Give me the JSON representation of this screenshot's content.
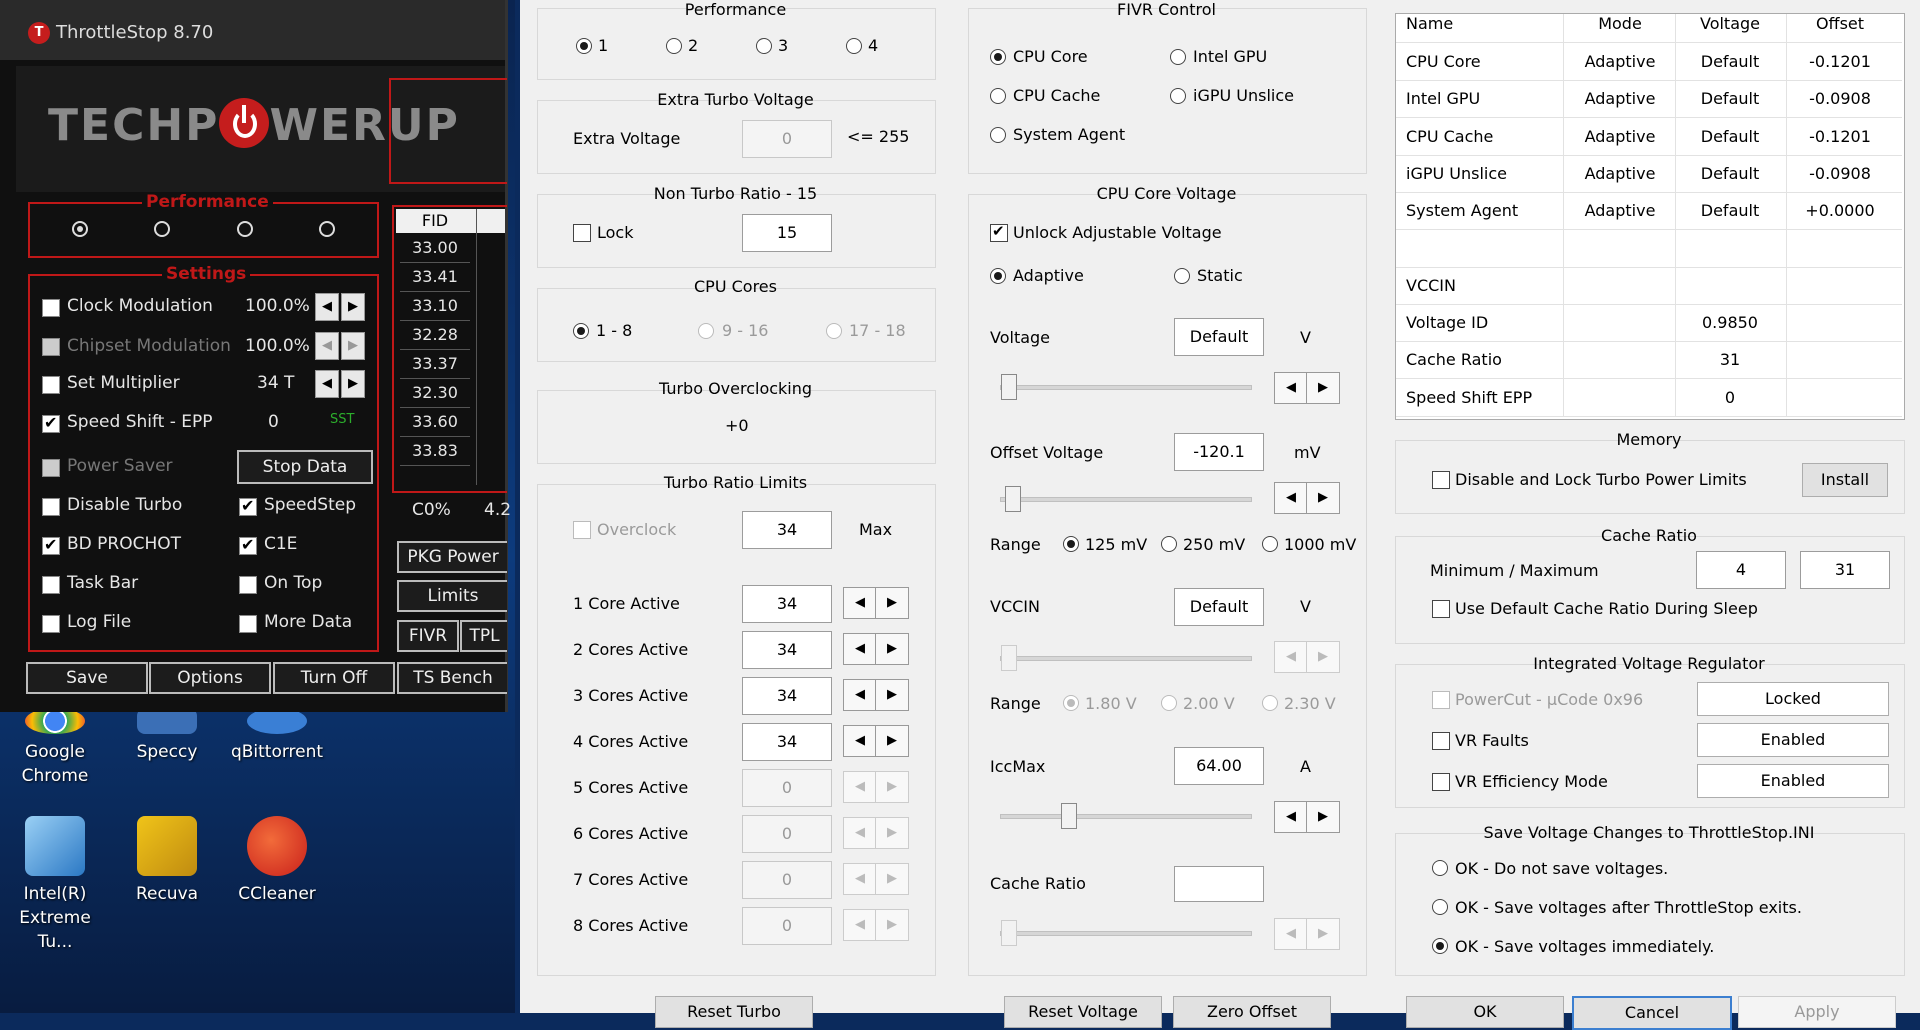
{
  "desktop": {
    "icons": [
      {
        "label1": "Google",
        "label2": "Chrome"
      },
      {
        "label1": "Speccy",
        "label2": ""
      },
      {
        "label1": "qBittorrent",
        "label2": ""
      },
      {
        "label1": "Intel(R)",
        "label2": "Extreme Tu..."
      },
      {
        "label1": "Recuva",
        "label2": ""
      },
      {
        "label1": "CCleaner",
        "label2": ""
      }
    ]
  },
  "ts": {
    "title": "ThrottleStop 8.70",
    "logo_icon": "T",
    "logo_pre": "TECHP",
    "logo_post": "WERUP",
    "performance_label": "Performance",
    "settings_label": "Settings",
    "rows": [
      {
        "label": "Clock Modulation",
        "value": "100.0%",
        "checked": false,
        "dim": false
      },
      {
        "label": "Chipset Modulation",
        "value": "100.0%",
        "checked": false,
        "dim": true
      },
      {
        "label": "Set Multiplier",
        "value": "34 T",
        "checked": false,
        "dim": false
      },
      {
        "label": "Speed Shift - EPP",
        "value": "0",
        "checked": true,
        "dim": false,
        "tag": "SST"
      }
    ],
    "checks": [
      {
        "label": "Power Saver",
        "checked": false,
        "dim": true
      },
      {
        "label": "Disable Turbo",
        "checked": false,
        "dim": false
      },
      {
        "label": "SpeedStep",
        "checked": true,
        "dim": false
      },
      {
        "label": "BD PROCHOT",
        "checked": true,
        "dim": false
      },
      {
        "label": "C1E",
        "checked": true,
        "dim": false
      },
      {
        "label": "Task Bar",
        "checked": false,
        "dim": false
      },
      {
        "label": "On Top",
        "checked": false,
        "dim": false
      },
      {
        "label": "Log File",
        "checked": false,
        "dim": false
      },
      {
        "label": "More Data",
        "checked": false,
        "dim": false
      }
    ],
    "stop_data": "Stop Data",
    "fid_header": "FID",
    "fid_values": [
      "33.00",
      "33.41",
      "33.10",
      "32.28",
      "33.37",
      "32.30",
      "33.60",
      "33.83"
    ],
    "c0_label": "C0%",
    "c0_value": "4.2",
    "side_buttons": [
      "PKG Power",
      "Limits",
      "FIVR",
      "TPL"
    ],
    "bottom_buttons": [
      "Save",
      "Options",
      "Turn Off",
      "TS Bench"
    ]
  },
  "dlg": {
    "performance": {
      "title": "Performance",
      "options": [
        "1",
        "2",
        "3",
        "4"
      ],
      "selected": 0
    },
    "extra_turbo": {
      "title": "Extra Turbo Voltage",
      "label": "Extra Voltage",
      "value": "0",
      "limit": "<= 255"
    },
    "non_turbo": {
      "title": "Non Turbo Ratio - 15",
      "lock": "Lock",
      "value": "15"
    },
    "cpu_cores": {
      "title": "CPU Cores",
      "options": [
        "1 - 8",
        "9 - 16",
        "17 - 18"
      ]
    },
    "turbo_oc": {
      "title": "Turbo Overclocking",
      "value": "+0"
    },
    "turbo_limits": {
      "title": "Turbo Ratio Limits",
      "overclock": "Overclock",
      "oc_value": "34",
      "max": "Max",
      "rows": [
        {
          "label": "1 Core Active",
          "value": "34"
        },
        {
          "label": "2 Cores Active",
          "value": "34"
        },
        {
          "label": "3 Cores Active",
          "value": "34"
        },
        {
          "label": "4 Cores Active",
          "value": "34"
        },
        {
          "label": "5 Cores Active",
          "value": "0"
        },
        {
          "label": "6 Cores Active",
          "value": "0"
        },
        {
          "label": "7 Cores Active",
          "value": "0"
        },
        {
          "label": "8 Cores Active",
          "value": "0"
        }
      ]
    },
    "reset_turbo": "Reset Turbo",
    "fivr_control": {
      "title": "FIVR Control",
      "options": [
        "CPU Core",
        "Intel GPU",
        "CPU Cache",
        "iGPU Unslice",
        "System Agent"
      ]
    },
    "core_voltage": {
      "title": "CPU Core Voltage",
      "unlock": "Unlock Adjustable Voltage",
      "adaptive": "Adaptive",
      "static": "Static",
      "voltage_label": "Voltage",
      "voltage_value": "Default",
      "voltage_unit": "V",
      "offset_label": "Offset Voltage",
      "offset_value": "-120.1",
      "offset_unit": "mV",
      "range_label": "Range",
      "range_options": [
        "125 mV",
        "250 mV",
        "1000 mV"
      ],
      "vccin_label": "VCCIN",
      "vccin_value": "Default",
      "vccin_unit": "V",
      "range2_label": "Range",
      "range2_options": [
        "1.80 V",
        "2.00 V",
        "2.30 V"
      ],
      "iccmax_label": "IccMax",
      "iccmax_value": "64.00",
      "iccmax_unit": "A",
      "cache_label": "Cache Ratio",
      "cache_value": ""
    },
    "reset_voltage": "Reset Voltage",
    "zero_offset": "Zero Offset",
    "table": {
      "headers": [
        "Name",
        "Mode",
        "Voltage",
        "Offset"
      ],
      "rows": [
        [
          "CPU Core",
          "Adaptive",
          "Default",
          "-0.1201"
        ],
        [
          "Intel GPU",
          "Adaptive",
          "Default",
          "-0.0908"
        ],
        [
          "CPU Cache",
          "Adaptive",
          "Default",
          "-0.1201"
        ],
        [
          "iGPU Unslice",
          "Adaptive",
          "Default",
          "-0.0908"
        ],
        [
          "System Agent",
          "Adaptive",
          "Default",
          "+0.0000"
        ],
        [
          "",
          "",
          "",
          ""
        ],
        [
          "VCCIN",
          "",
          "",
          ""
        ],
        [
          "Voltage ID",
          "",
          "0.9850",
          ""
        ],
        [
          "Cache Ratio",
          "",
          "31",
          ""
        ],
        [
          "Speed Shift EPP",
          "",
          "0",
          ""
        ]
      ]
    },
    "memory": {
      "title": "Memory",
      "label": "Disable and Lock Turbo Power Limits",
      "install": "Install"
    },
    "cache_ratio": {
      "title": "Cache Ratio",
      "label": "Minimum / Maximum",
      "min": "4",
      "max": "31",
      "sleep": "Use Default Cache Ratio During Sleep"
    },
    "ivr": {
      "title": "Integrated Voltage Regulator",
      "powercut": "PowerCut  -  µCode 0x96",
      "powercut_btn": "Locked",
      "vr_faults": "VR Faults",
      "vr_faults_btn": "Enabled",
      "vr_eff": "VR Efficiency Mode",
      "vr_eff_btn": "Enabled"
    },
    "save_ini": {
      "title": "Save Voltage Changes to ThrottleStop.INI",
      "options": [
        "OK - Do not save voltages.",
        "OK - Save voltages after ThrottleStop exits.",
        "OK - Save voltages immediately."
      ]
    },
    "ok": "OK",
    "cancel": "Cancel",
    "apply": "Apply"
  }
}
